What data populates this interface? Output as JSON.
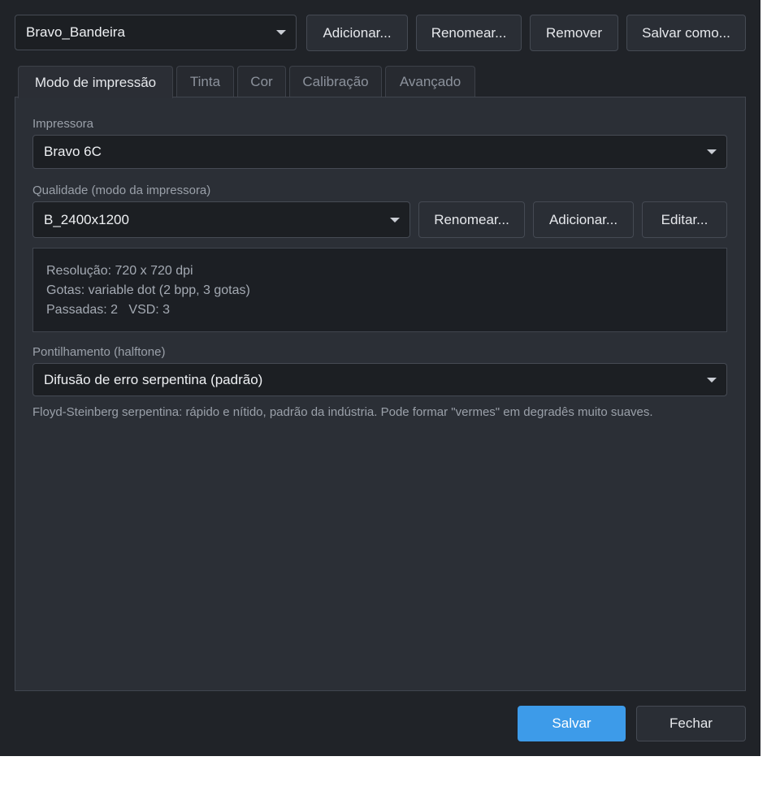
{
  "profile": {
    "selected": "Bravo_Bandeira",
    "buttons": {
      "add": "Adicionar...",
      "rename": "Renomear...",
      "remove": "Remover",
      "save_as": "Salvar como..."
    }
  },
  "tabs": [
    {
      "label": "Modo de impressão",
      "active": true
    },
    {
      "label": "Tinta",
      "active": false
    },
    {
      "label": "Cor",
      "active": false
    },
    {
      "label": "Calibração",
      "active": false
    },
    {
      "label": "Avançado",
      "active": false
    }
  ],
  "printer": {
    "label": "Impressora",
    "value": "Bravo 6C"
  },
  "quality": {
    "label": "Qualidade (modo da impressora)",
    "value": "B_2400x1200",
    "buttons": {
      "rename": "Renomear...",
      "add": "Adicionar...",
      "edit": "Editar..."
    },
    "info": {
      "resolution": "Resolução: 720 x 720 dpi",
      "drops": "Gotas: variable dot (2 bpp, 3 gotas)",
      "passes": "Passadas: 2   VSD: 3"
    }
  },
  "halftone": {
    "label": "Pontilhamento (halftone)",
    "value": "Difusão de erro serpentina (padrão)",
    "description": "Floyd-Steinberg serpentina: rápido e nítido, padrão da indústria. Pode formar \"vermes\" em degradês muito suaves."
  },
  "footer": {
    "save": "Salvar",
    "close": "Fechar"
  },
  "colors": {
    "accent": "#3d9be9",
    "background": "#202328",
    "panel": "#2b2f36"
  }
}
